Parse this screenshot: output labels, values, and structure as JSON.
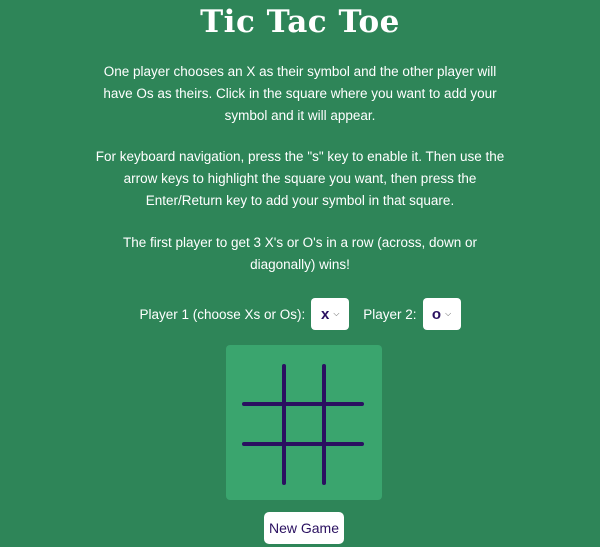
{
  "title": "Tic Tac Toe",
  "instructions": [
    "One player chooses an X as their symbol and the other player will have Os as theirs. Click in the square where you want to add your symbol and it will appear.",
    "For keyboard navigation, press the \"s\" key to enable it. Then use the arrow keys to highlight the square you want, then press the Enter/Return key to add your symbol in that square.",
    "The first player to get 3 X's or O's in a row (across, down or diagonally) wins!"
  ],
  "player1": {
    "label": "Player 1 (choose Xs or Os):",
    "selected": "x"
  },
  "player2": {
    "label": "Player 2:",
    "selected": "o"
  },
  "board": {
    "cells": [
      "",
      "",
      "",
      "",
      "",
      "",
      "",
      "",
      ""
    ]
  },
  "new_game_label": "New Game",
  "colors": {
    "background": "#2e8558",
    "board": "#3aa56e",
    "grid_lines": "#2a1060"
  }
}
